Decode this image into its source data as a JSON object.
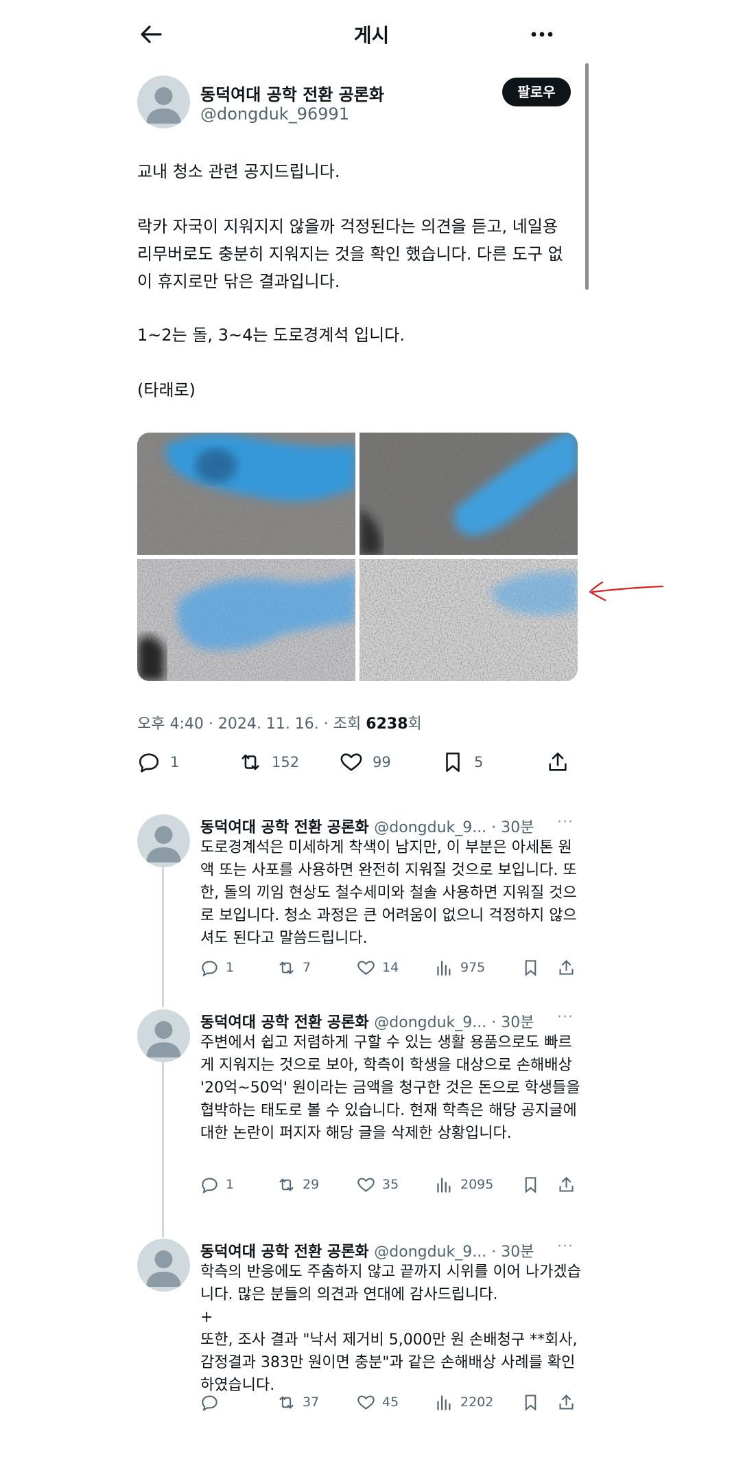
{
  "header": {
    "title": "게시"
  },
  "author": {
    "name": "동덕여대 공학 전환 공론화",
    "handle": "@dongduk_96991",
    "follow_label": "팔로우"
  },
  "post": {
    "line1": "교내 청소 관련 공지드립니다.",
    "para2": "락카 자국이 지워지지 않을까 걱정된다는 의견을 듣고, 네일용 리무버로도 충분히 지워지는 것을 확인 했습니다. 다른 도구 없이 휴지로만 닦은 결과입니다.",
    "line3": "1~2는 돌, 3~4는 도로경계석 입니다.",
    "line4": "(타래로)",
    "meta_prefix": "오후 4:40 · 2024. 11. 16. · 조회 ",
    "views": "6238",
    "meta_suffix": "회",
    "stats": {
      "replies": "1",
      "reposts": "152",
      "likes": "99",
      "bookmarks": "5"
    }
  },
  "replies": [
    {
      "name": "동덕여대 공학 전환 공론화",
      "handle_time": "@dongduk_9... · 30분",
      "text": "도로경계석은 미세하게 착색이 남지만, 이 부분은 아세톤 원액 또는 사포를 사용하면 완전히 지워질 것으로 보입니다. 또한, 돌의 끼임 현상도 철수세미와 철솔 사용하면 지워질 것으로 보입니다. 청소 과정은 큰 어려움이 없으니 걱정하지 않으셔도 된다고 말씀드립니다.",
      "replies": "1",
      "reposts": "7",
      "likes": "14",
      "views": "975"
    },
    {
      "name": "동덕여대 공학 전환 공론화",
      "handle_time": "@dongduk_9... · 30분",
      "text": "주변에서 쉽고 저렴하게 구할 수 있는 생활 용품으로도 빠르게 지워지는 것으로 보아, 학측이 학생을 대상으로 손해배상 '20억~50억' 원이라는 금액을 청구한 것은 돈으로 학생들을 협박하는 태도로 볼 수 있습니다. 현재 학측은 해당 공지글에 대한 논란이 퍼지자 해당 글을 삭제한 상황입니다.",
      "replies": "1",
      "reposts": "29",
      "likes": "35",
      "views": "2095"
    },
    {
      "name": "동덕여대 공학 전환 공론화",
      "handle_time": "@dongduk_9... · 30분",
      "text": "학측의 반응에도 주춤하지 않고 끝까지 시위를 이어 나가겠습니다. 많은 분들의 의견과 연대에 감사드립니다.\n+\n또한, 조사 결과 \"낙서 제거비 5,000만 원 손배청구 **회사, 감정결과 383만 원이면 충분\"과 같은 손해배상 사례를 확인하였습니다.",
      "replies": "",
      "reposts": "37",
      "likes": "45",
      "views": "2202"
    }
  ],
  "icons": [
    "back-arrow-icon",
    "more-icon",
    "reply-icon",
    "repost-icon",
    "like-icon",
    "bookmark-icon",
    "share-icon",
    "views-icon"
  ],
  "colors": {
    "text": "#0f1419",
    "secondary": "#536471",
    "paint_blue": "#2f9ae0",
    "annotation_red": "#e02020"
  }
}
